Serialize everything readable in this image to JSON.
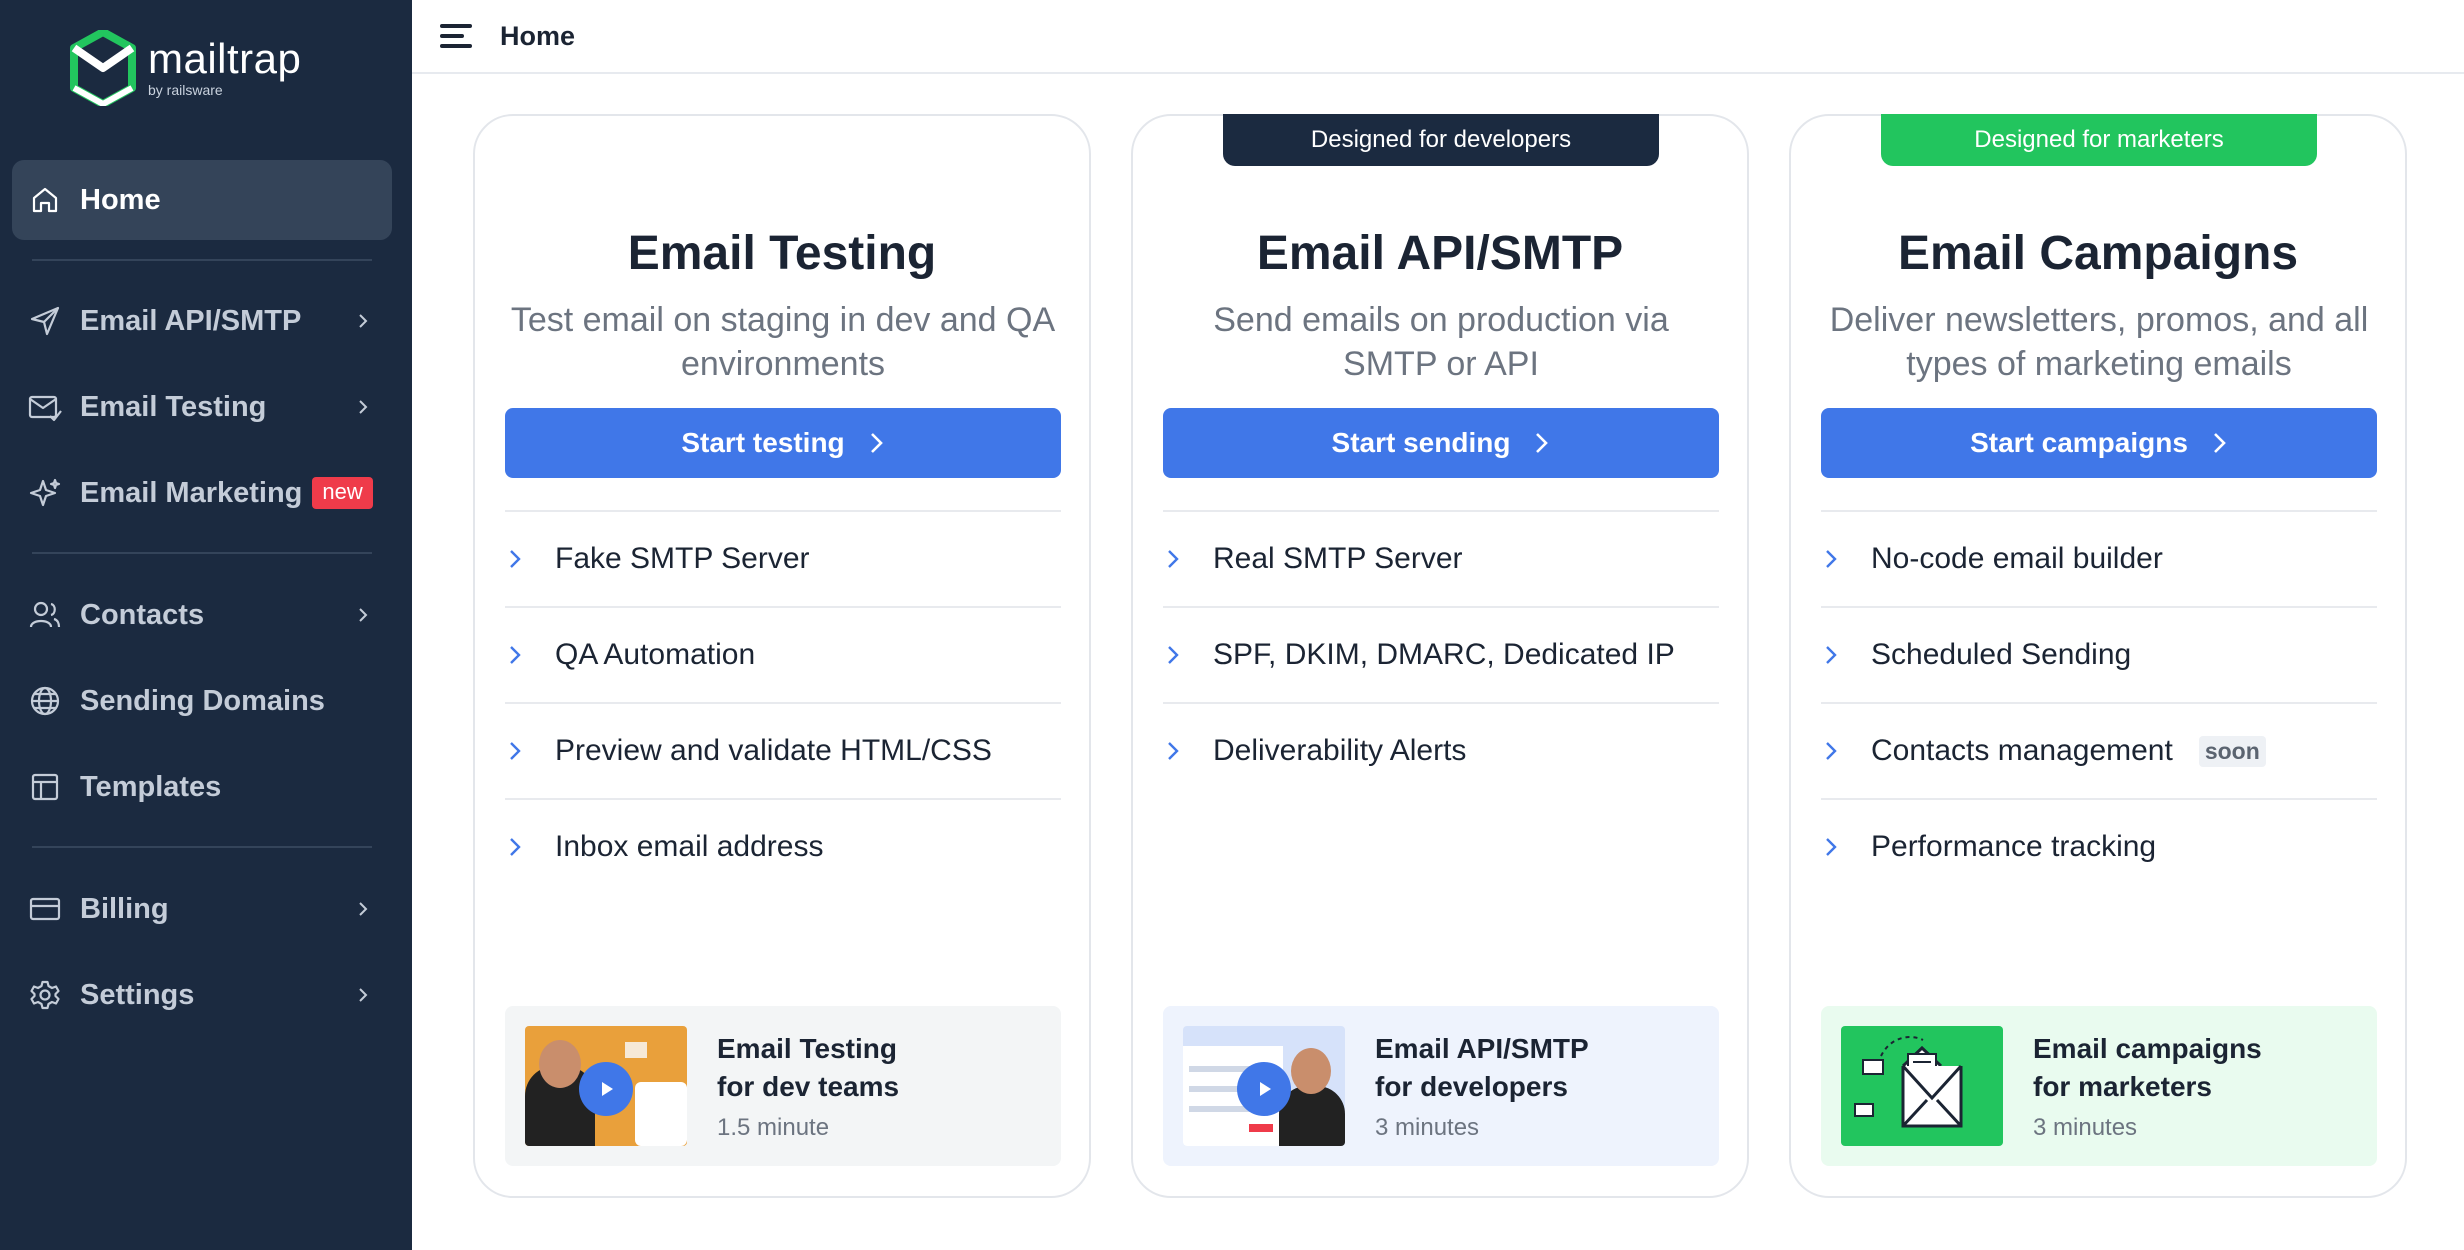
{
  "brand": {
    "name": "mailtrap",
    "by": "by railsware"
  },
  "topbar": {
    "title": "Home"
  },
  "sidebar": {
    "items": [
      {
        "label": "Home",
        "icon": "home-icon"
      },
      {
        "label": "Email API/SMTP",
        "icon": "send-icon"
      },
      {
        "label": "Email Testing",
        "icon": "email-testing-icon"
      },
      {
        "label": "Email Marketing",
        "icon": "sparkle-icon",
        "badge": "new"
      },
      {
        "label": "Contacts",
        "icon": "contacts-icon"
      },
      {
        "label": "Sending Domains",
        "icon": "globe-icon"
      },
      {
        "label": "Templates",
        "icon": "templates-icon"
      },
      {
        "label": "Billing",
        "icon": "credit-card-icon"
      },
      {
        "label": "Settings",
        "icon": "gear-icon"
      }
    ]
  },
  "cards": [
    {
      "title": "Email Testing",
      "description": "Test email on staging in dev and QA environments",
      "cta": "Start testing",
      "features": [
        "Fake SMTP Server",
        "QA Automation",
        "Preview and validate HTML/CSS",
        "Inbox email address"
      ],
      "video": {
        "line1": "Email Testing",
        "line2": "for dev teams",
        "duration": "1.5 minute"
      }
    },
    {
      "flag": "Designed for developers",
      "title": "Email API/SMTP",
      "description": "Send emails on production via SMTP or API",
      "cta": "Start sending",
      "features": [
        "Real SMTP Server",
        "SPF, DKIM, DMARC, Dedicated IP",
        "Deliverability Alerts"
      ],
      "video": {
        "line1": "Email API/SMTP",
        "line2": "for developers",
        "duration": "3 minutes"
      }
    },
    {
      "flag": "Designed for marketers",
      "title": "Email Campaigns",
      "description": "Deliver newsletters, promos, and all types of marketing emails",
      "cta": "Start campaigns",
      "features": [
        "No-code email builder",
        "Scheduled Sending",
        "Contacts management",
        "Performance tracking"
      ],
      "feature_badge": "soon",
      "video": {
        "line1": "Email campaigns",
        "line2": "for marketers",
        "duration": "3 minutes"
      }
    }
  ],
  "colors": {
    "sidebar_bg": "#1b2a40",
    "active_item_bg": "#344459",
    "primary": "#4077e8",
    "developers_flag": "#1b2a40",
    "marketers_flag": "#22c55e",
    "new_badge": "#ef3b4a"
  }
}
